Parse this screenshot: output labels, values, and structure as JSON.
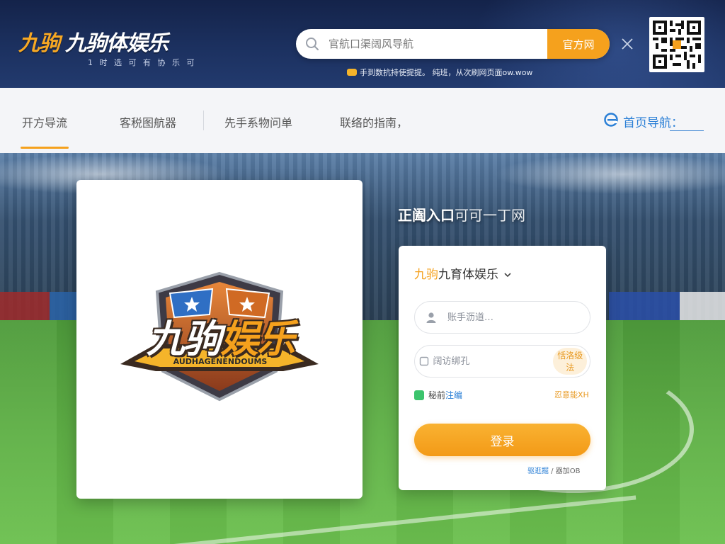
{
  "header": {
    "brand_mark": "九驹",
    "brand_name": "九驹体娱乐",
    "slogan": "1 时 选 可 有 协 乐 可",
    "search": {
      "placeholder": "官航口渠阔风导航",
      "button_label": "官方网"
    },
    "notice": "手到数抗持使提提。 纯班，从次刷网页面ow.wow",
    "colors": {
      "accent": "#f5a11d",
      "header_bg": "#1c3160"
    }
  },
  "nav": {
    "items": [
      {
        "label": "开方导流",
        "active": true
      },
      {
        "label": "客税图航器",
        "active": false
      },
      {
        "label": "先手系物问单",
        "active": false
      },
      {
        "label": "联络的指南，",
        "active": false
      }
    ],
    "right": {
      "icon": "ie-browser-icon",
      "label": "首页导航："
    }
  },
  "hero": {
    "logo": {
      "text_main": "九驹",
      "text_accent": "娱乐",
      "subtitle": "AUDHAGENENDOUMS"
    },
    "title_bold": "正阖入口",
    "title_light": "可可一丁网",
    "login": {
      "brand_accent": "九驹",
      "brand_rest": "九育体娱乐",
      "username_placeholder": "账手沥道…",
      "captcha_placeholder": "阔访绑孔",
      "captcha_button": "恬洛级法",
      "remember_prefix": "秘前",
      "remember_link": "注编",
      "forgot": "忍意能XH",
      "login_button": "登录",
      "footer_link": "驱逛掘",
      "footer_text": " / 器加OB"
    }
  }
}
